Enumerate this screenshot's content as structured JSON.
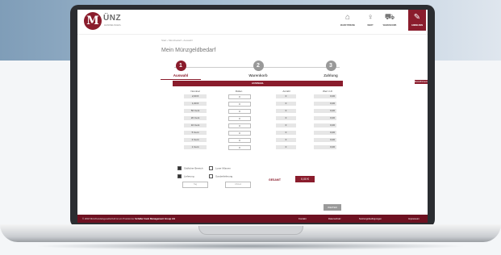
{
  "brand": {
    "logo_letter": "M",
    "name": "ÜNZ",
    "sub": "HANDELSGES."
  },
  "header_nav": [
    {
      "label": "Marktpreise",
      "icon": "bank-icon"
    },
    {
      "label": "Wert",
      "icon": "piggy-icon"
    },
    {
      "label": "Warenkorb",
      "icon": "cart-icon"
    },
    {
      "label": "Anmelden",
      "icon": "edit-icon",
      "active": true
    }
  ],
  "breadcrumb": "Start › Münzbedarf › Auswahl",
  "page_title": "Mein Münzgeldbedarf",
  "steps": [
    {
      "num": "1",
      "label": "Auswahl",
      "active": true
    },
    {
      "num": "2",
      "label": "Warenkorb",
      "active": false
    },
    {
      "num": "3",
      "label": "Zahlung",
      "active": false
    }
  ],
  "table": {
    "title": "AUSWAHL",
    "side_button": "Bestellhinweise",
    "columns": [
      "Nominal",
      "Rollen",
      "Anzahl",
      "Wert in €"
    ],
    "rows": [
      {
        "nominal": "2,00 €",
        "rollen": "0",
        "anzahl": "0",
        "wert": "0,00"
      },
      {
        "nominal": "1,00 €",
        "rollen": "0",
        "anzahl": "0",
        "wert": "0,00"
      },
      {
        "nominal": "50 Cent",
        "rollen": "0",
        "anzahl": "0",
        "wert": "0,00"
      },
      {
        "nominal": "20 Cent",
        "rollen": "0",
        "anzahl": "0",
        "wert": "0,00"
      },
      {
        "nominal": "10 Cent",
        "rollen": "0",
        "anzahl": "0",
        "wert": "0,00"
      },
      {
        "nominal": "5 Cent",
        "rollen": "0",
        "anzahl": "0",
        "wert": "0,00"
      },
      {
        "nominal": "2 Cent",
        "rollen": "0",
        "anzahl": "0",
        "wert": "0,00"
      },
      {
        "nominal": "1 Cent",
        "rollen": "0",
        "anzahl": "0",
        "wert": "0,00"
      }
    ]
  },
  "options": {
    "left": [
      {
        "label": "Südlicher Bereich",
        "checked": true
      },
      {
        "label": "Lieferung",
        "checked": true
      }
    ],
    "right": [
      {
        "label": "Loser Münzen",
        "checked": false
      },
      {
        "label": "Sonderlieferung",
        "checked": false
      }
    ],
    "date_placeholder": "Tag",
    "time_placeholder": "Uhrzeit"
  },
  "total": {
    "label": "GESAMT",
    "value": "0,00 €"
  },
  "next_button": "WEITER",
  "footer": {
    "text_prefix": "© 2018 Münzhandelsgesellschaft ist ein Produkt der",
    "company": "Schäfer Cash Management Group AG",
    "links": [
      "Kontakt",
      "Datenschutz",
      "Nutzungsbedingungen",
      "Impressum"
    ]
  },
  "colors": {
    "accent": "#8a1c2c",
    "footer": "#6e1121"
  }
}
